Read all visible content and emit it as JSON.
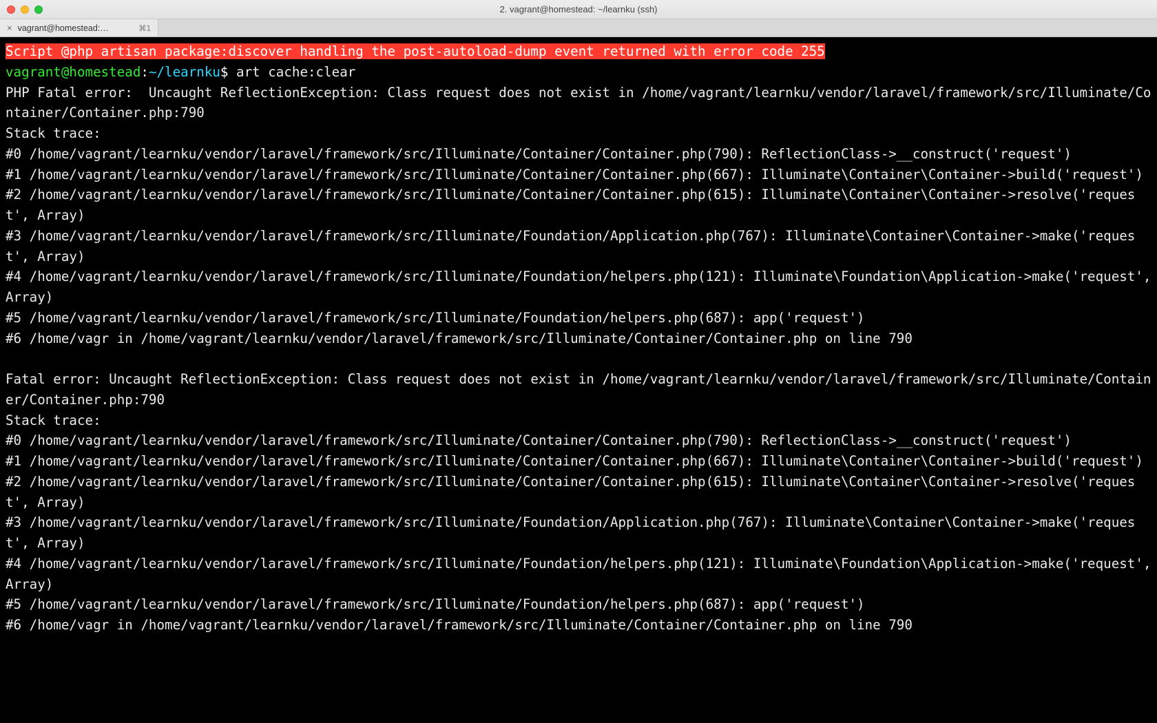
{
  "window": {
    "title": "2. vagrant@homestead: ~/learnku (ssh)"
  },
  "tab": {
    "label": "vagrant@homestead:…",
    "shortcut": "⌘1"
  },
  "errorBanner": "Script @php artisan package:discover handling the post-autoload-dump event returned with error code 255",
  "prompt": {
    "user": "vagrant@homestead",
    "sep1": ":",
    "path": "~/learnku",
    "sep2": "$ ",
    "command": "art cache:clear"
  },
  "block1": {
    "l0": "PHP Fatal error:  Uncaught ReflectionException: Class request does not exist in /home/vagrant/learnku/vendor/laravel/framework/src/Illuminate/Container/Container.php:790",
    "l1": "Stack trace:",
    "l2": "#0 /home/vagrant/learnku/vendor/laravel/framework/src/Illuminate/Container/Container.php(790): ReflectionClass->__construct('request')",
    "l3": "#1 /home/vagrant/learnku/vendor/laravel/framework/src/Illuminate/Container/Container.php(667): Illuminate\\Container\\Container->build('request')",
    "l4": "#2 /home/vagrant/learnku/vendor/laravel/framework/src/Illuminate/Container/Container.php(615): Illuminate\\Container\\Container->resolve('request', Array)",
    "l5": "#3 /home/vagrant/learnku/vendor/laravel/framework/src/Illuminate/Foundation/Application.php(767): Illuminate\\Container\\Container->make('request', Array)",
    "l6": "#4 /home/vagrant/learnku/vendor/laravel/framework/src/Illuminate/Foundation/helpers.php(121): Illuminate\\Foundation\\Application->make('request', Array)",
    "l7": "#5 /home/vagrant/learnku/vendor/laravel/framework/src/Illuminate/Foundation/helpers.php(687): app('request')",
    "l8": "#6 /home/vagr in /home/vagrant/learnku/vendor/laravel/framework/src/Illuminate/Container/Container.php on line 790"
  },
  "block2": {
    "l0": "Fatal error: Uncaught ReflectionException: Class request does not exist in /home/vagrant/learnku/vendor/laravel/framework/src/Illuminate/Container/Container.php:790",
    "l1": "Stack trace:",
    "l2": "#0 /home/vagrant/learnku/vendor/laravel/framework/src/Illuminate/Container/Container.php(790): ReflectionClass->__construct('request')",
    "l3": "#1 /home/vagrant/learnku/vendor/laravel/framework/src/Illuminate/Container/Container.php(667): Illuminate\\Container\\Container->build('request')",
    "l4": "#2 /home/vagrant/learnku/vendor/laravel/framework/src/Illuminate/Container/Container.php(615): Illuminate\\Container\\Container->resolve('request', Array)",
    "l5": "#3 /home/vagrant/learnku/vendor/laravel/framework/src/Illuminate/Foundation/Application.php(767): Illuminate\\Container\\Container->make('request', Array)",
    "l6": "#4 /home/vagrant/learnku/vendor/laravel/framework/src/Illuminate/Foundation/helpers.php(121): Illuminate\\Foundation\\Application->make('request', Array)",
    "l7": "#5 /home/vagrant/learnku/vendor/laravel/framework/src/Illuminate/Foundation/helpers.php(687): app('request')",
    "l8": "#6 /home/vagr in /home/vagrant/learnku/vendor/laravel/framework/src/Illuminate/Container/Container.php on line 790"
  }
}
